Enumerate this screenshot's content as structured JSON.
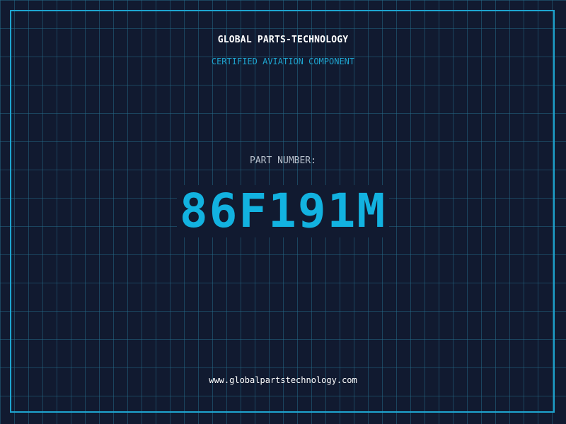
{
  "header": {
    "company": "GLOBAL PARTS-TECHNOLOGY",
    "tagline": "CERTIFIED AVIATION COMPONENT"
  },
  "part": {
    "label": "PART NUMBER:",
    "number": "86F191M"
  },
  "footer": {
    "url": "www.globalpartstechnology.com"
  },
  "colors": {
    "background": "#111a30",
    "grid": "#266e8c",
    "accent": "#1ea5d0",
    "part_number": "#12b2e0",
    "text": "#ffffff",
    "muted_text": "#b7c0cc"
  }
}
